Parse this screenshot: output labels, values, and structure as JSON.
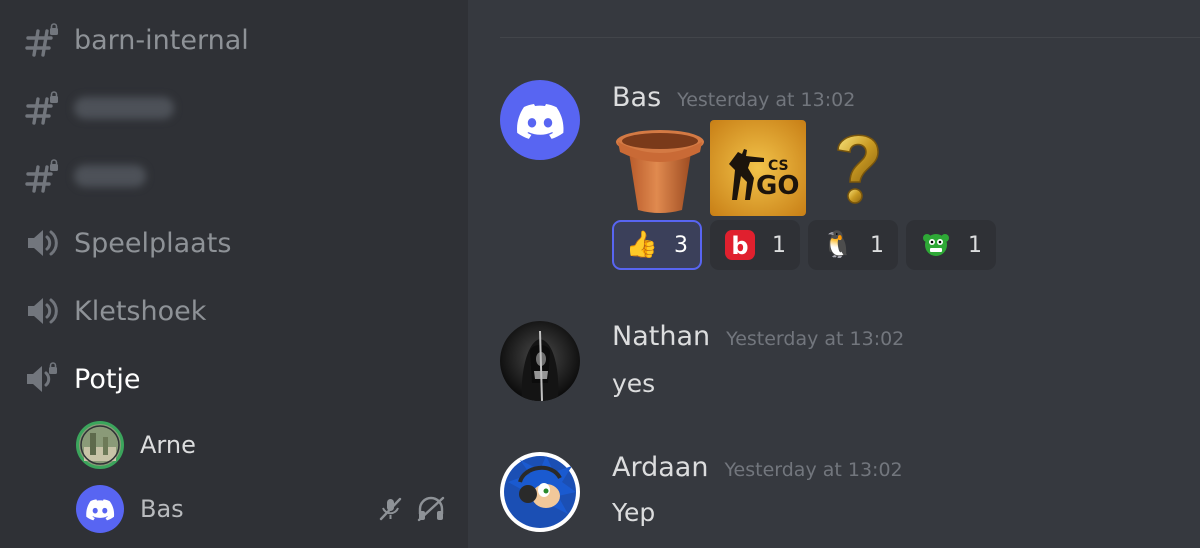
{
  "sidebar": {
    "channels": [
      {
        "type": "text-locked",
        "name": "barn-internal",
        "blurred": false
      },
      {
        "type": "text-locked",
        "name": "",
        "blurred": true
      },
      {
        "type": "text-locked",
        "name": "",
        "blurred": true
      },
      {
        "type": "voice",
        "name": "Speelplaats",
        "blurred": false
      },
      {
        "type": "voice",
        "name": "Kletshoek",
        "blurred": false
      },
      {
        "type": "voice-locked",
        "name": "Potje",
        "blurred": false,
        "active": true
      }
    ],
    "voice_users": [
      {
        "name": "Arne",
        "avatar": "landscape-avatar",
        "speaking": true
      },
      {
        "name": "Bas",
        "avatar": "discord-logo-avatar",
        "muted": true,
        "deafened": true
      }
    ]
  },
  "messages": [
    {
      "author": "Bas",
      "timestamp": "Yesterday at 13:02",
      "avatar": "discord-logo-avatar",
      "emojis": [
        "flower-pot",
        "csgo-logo",
        "golden-question-mark"
      ],
      "reactions": [
        {
          "emoji": "👍",
          "name": "thumbs-up-icon",
          "count": "3",
          "me": true
        },
        {
          "emoji": "b",
          "name": "red-b-icon",
          "count": "1",
          "me": false
        },
        {
          "emoji": "🐧",
          "name": "penguin-icon",
          "count": "1",
          "me": false
        },
        {
          "emoji": "👾",
          "name": "green-monster-icon",
          "count": "1",
          "me": false
        }
      ]
    },
    {
      "author": "Nathan",
      "timestamp": "Yesterday at 13:02",
      "avatar": "dark-guitarist-avatar",
      "text": "yes"
    },
    {
      "author": "Ardaan",
      "timestamp": "Yesterday at 13:02",
      "avatar": "sonic-avatar",
      "text": "Yep"
    }
  ],
  "colors": {
    "sidebar_bg": "#2f3136",
    "chat_bg": "#36393f",
    "blurple": "#5865f2",
    "muted_text": "#8e9297"
  }
}
